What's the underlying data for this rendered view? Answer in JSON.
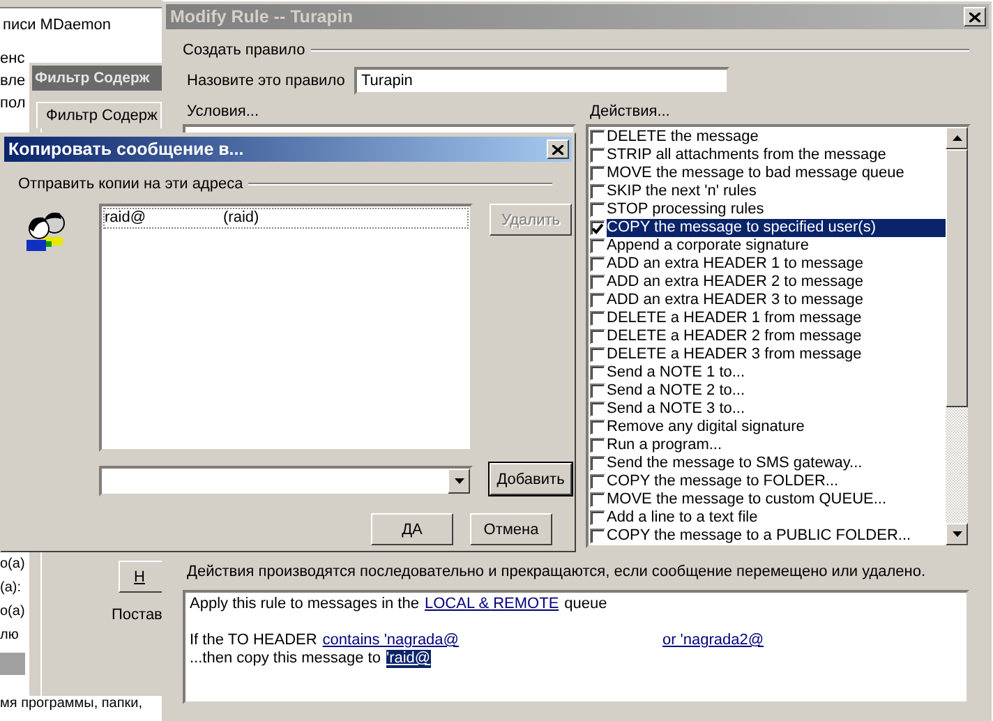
{
  "back_window": {
    "title_fragment": "писи MDaemon",
    "left_fragments": [
      "енс",
      "вле",
      "пол"
    ],
    "lower_fragments": [
      "о(а)",
      "(а):",
      "о(а)",
      "лю"
    ],
    "bottom_fragment": "мя программы, папки,"
  },
  "filter_window": {
    "title": "Фильтр Содерж",
    "tab": "Фильтр Содерж",
    "button": "Н",
    "label": "Постав"
  },
  "modify_rule": {
    "title": "Modify Rule -- Turapin",
    "group": "Создать правило",
    "name_label": "Назовите это правило",
    "name_value": "Turapin",
    "conditions_label": "Условия...",
    "actions_label": "Действия...",
    "actions": [
      {
        "label": "DELETE the message",
        "checked": false,
        "selected": false
      },
      {
        "label": "STRIP all attachments from the message",
        "checked": false,
        "selected": false
      },
      {
        "label": "MOVE the message to bad message queue",
        "checked": false,
        "selected": false
      },
      {
        "label": "SKIP the next 'n' rules",
        "checked": false,
        "selected": false
      },
      {
        "label": "STOP processing rules",
        "checked": false,
        "selected": false
      },
      {
        "label": "COPY the message to specified user(s)",
        "checked": true,
        "selected": true
      },
      {
        "label": "Append a corporate signature",
        "checked": false,
        "selected": false
      },
      {
        "label": "ADD an extra HEADER 1 to message",
        "checked": false,
        "selected": false
      },
      {
        "label": "ADD an extra HEADER 2 to message",
        "checked": false,
        "selected": false
      },
      {
        "label": "ADD an extra HEADER 3 to message",
        "checked": false,
        "selected": false
      },
      {
        "label": "DELETE a HEADER 1 from message",
        "checked": false,
        "selected": false
      },
      {
        "label": "DELETE a HEADER 2 from message",
        "checked": false,
        "selected": false
      },
      {
        "label": "DELETE a HEADER 3 from message",
        "checked": false,
        "selected": false
      },
      {
        "label": "Send a NOTE 1 to...",
        "checked": false,
        "selected": false
      },
      {
        "label": "Send a NOTE 2 to...",
        "checked": false,
        "selected": false
      },
      {
        "label": "Send a NOTE 3 to...",
        "checked": false,
        "selected": false
      },
      {
        "label": "Remove any digital signature",
        "checked": false,
        "selected": false
      },
      {
        "label": "Run a program...",
        "checked": false,
        "selected": false
      },
      {
        "label": "Send the message to SMS gateway...",
        "checked": false,
        "selected": false
      },
      {
        "label": "COPY the message to FOLDER...",
        "checked": false,
        "selected": false
      },
      {
        "label": "MOVE the message to custom QUEUE...",
        "checked": false,
        "selected": false
      },
      {
        "label": "Add a line to a text file",
        "checked": false,
        "selected": false
      },
      {
        "label": "COPY the message to a PUBLIC FOLDER...",
        "checked": false,
        "selected": false
      }
    ],
    "note": "Действия производятся последовательно и прекращаются, если сообщение перемещено или удалено.",
    "description": [
      {
        "gap_before": false,
        "segments": [
          {
            "kind": "text",
            "text": "Apply this rule to messages in the"
          },
          {
            "kind": "link",
            "text": "LOCAL & REMOTE"
          },
          {
            "kind": "text",
            "text": "queue"
          }
        ]
      },
      {
        "gap_before": true,
        "segments": [
          {
            "kind": "text",
            "text": "If the TO HEADER"
          },
          {
            "kind": "link",
            "text": "contains 'nagrada@"
          },
          {
            "kind": "spacer"
          },
          {
            "kind": "link",
            "text": "or 'nagrada2@"
          }
        ]
      },
      {
        "gap_before": false,
        "segments": [
          {
            "kind": "text",
            "text": "...then copy this message to"
          },
          {
            "kind": "selected",
            "text": "'raid@"
          }
        ]
      }
    ]
  },
  "copy_dialog": {
    "title": "Копировать сообщение в...",
    "group": "Отправить копии на эти адреса",
    "recipients": [
      {
        "address": "raid@",
        "name": "(raid)",
        "selected": true
      }
    ],
    "remove_button": {
      "label": "Удалить",
      "disabled": true
    },
    "add_button": "Добавить",
    "ok_button": "ДА",
    "cancel_button": "Отмена"
  }
}
